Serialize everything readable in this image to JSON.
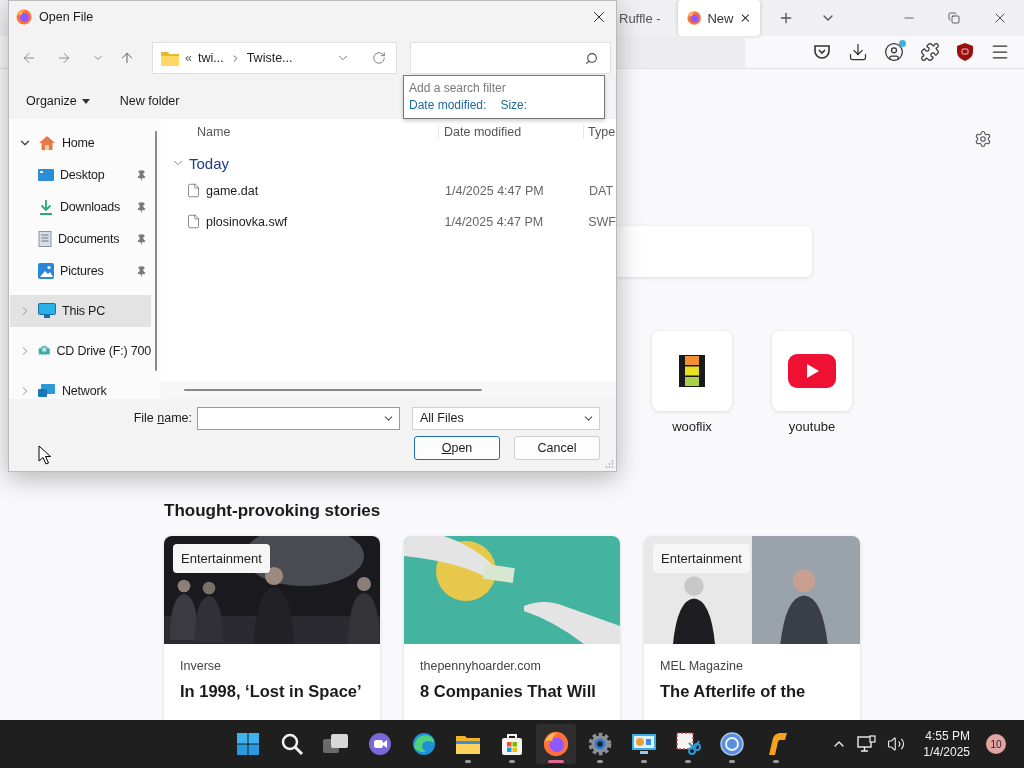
{
  "browser": {
    "tabs": [
      {
        "title": "Ruffle -",
        "selected": false
      },
      {
        "title": "New",
        "selected": true
      }
    ],
    "shortcuts": [
      {
        "label": "wooflix",
        "kind": "film"
      },
      {
        "label": "youtube",
        "kind": "video"
      }
    ],
    "stories": {
      "heading": "Thought-provoking stories",
      "cards": [
        {
          "tag": "Entertainment",
          "source": "Inverse",
          "title": "In 1998, ‘Lost in Space’"
        },
        {
          "source": "thepennyhoarder.com",
          "title": "8 Companies That Will"
        },
        {
          "tag": "Entertainment",
          "source": "MEL Magazine",
          "title": "The Afterlife of the"
        }
      ]
    }
  },
  "dialog": {
    "title": "Open File",
    "breadcrumb": {
      "overflow": "«",
      "parts": [
        "twi...",
        "Twiste..."
      ]
    },
    "search_filter": {
      "title": "Add a search filter",
      "filters": [
        "Date modified:",
        "Size:"
      ]
    },
    "commands": [
      {
        "label": "Organize",
        "menu": true
      },
      {
        "label": "New folder",
        "menu": false
      }
    ],
    "sidebar": [
      {
        "label": "Home",
        "kind": "home",
        "expanded": true,
        "selected": false,
        "children": [
          {
            "label": "Desktop",
            "kind": "desktop",
            "pinned": true,
            "selected": false
          },
          {
            "label": "Downloads",
            "kind": "downloads",
            "pinned": true,
            "selected": false
          },
          {
            "label": "Documents",
            "kind": "documents",
            "pinned": true,
            "selected": false
          },
          {
            "label": "Pictures",
            "kind": "pictures",
            "pinned": true,
            "selected": false
          }
        ]
      },
      {
        "label": "This PC",
        "kind": "pc",
        "expanded": false,
        "selected": true
      },
      {
        "label": "CD Drive (F:) 700",
        "kind": "cd",
        "expanded": false,
        "selected": false
      },
      {
        "label": "Network",
        "kind": "network",
        "expanded": false,
        "selected": false
      }
    ],
    "columns": [
      "Name",
      "Date modified",
      "Type"
    ],
    "groups": [
      {
        "label": "Today",
        "expanded": true,
        "files": [
          {
            "name": "game.dat",
            "date": "1/4/2025 4:47 PM",
            "type": "DAT",
            "selected": false
          },
          {
            "name": "plosinovka.swf",
            "date": "1/4/2025 4:47 PM",
            "type": "SWF",
            "selected": false
          }
        ]
      }
    ],
    "file_name": {
      "before": "File ",
      "access_key": "n",
      "after": "ame:"
    },
    "file_type": "All Files",
    "buttons": [
      {
        "access_key": "O",
        "text": "pen",
        "default": true
      },
      {
        "text": "Cancel",
        "default": false
      }
    ]
  },
  "taskbar": {
    "apps": [
      {
        "kind": "start",
        "running": false,
        "selected": false
      },
      {
        "kind": "search",
        "running": false,
        "selected": false
      },
      {
        "kind": "taskview",
        "running": false,
        "selected": false
      },
      {
        "kind": "chat",
        "running": false,
        "selected": false
      },
      {
        "kind": "edge",
        "running": false,
        "selected": false
      },
      {
        "kind": "explorer",
        "running": true,
        "selected": false
      },
      {
        "kind": "store",
        "running": true,
        "selected": false
      },
      {
        "kind": "firefox",
        "running": true,
        "selected": true
      },
      {
        "kind": "settings",
        "running": true,
        "selected": false
      },
      {
        "kind": "monitor",
        "running": true,
        "selected": false
      },
      {
        "kind": "snipping",
        "running": true,
        "selected": false
      },
      {
        "kind": "torrent",
        "running": true,
        "selected": false
      },
      {
        "kind": "hook",
        "running": true,
        "selected": false
      }
    ],
    "time": "4:55 PM",
    "date": "1/4/2025",
    "notifications": "10"
  }
}
